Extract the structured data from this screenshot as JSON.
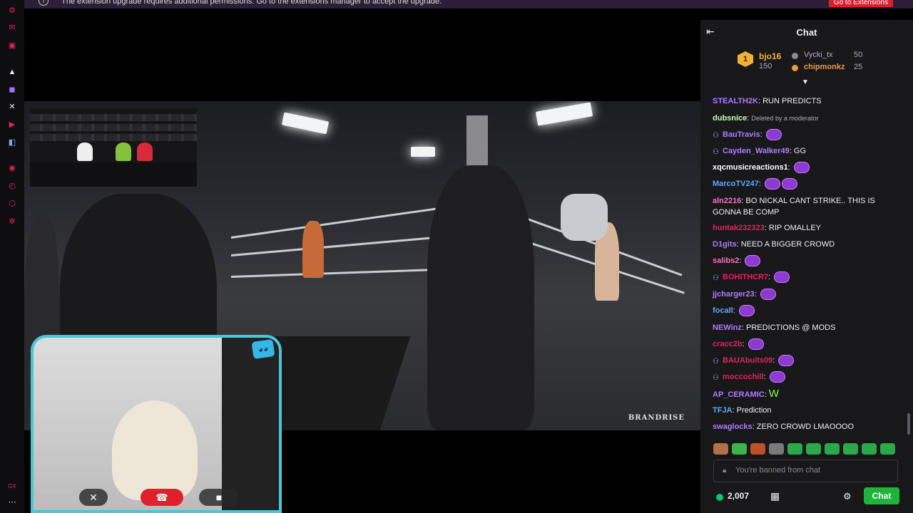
{
  "notification": {
    "message": "The extension upgrade requires additional permissions. Go to the extensions manager to accept the upgrade.",
    "button": "Go to Extensions",
    "icon": "info-icon"
  },
  "rail": {
    "icons": [
      "red-robot-icon",
      "red-chat-icon",
      "red-card-icon",
      "white-kick-icon",
      "purple-twitch-icon",
      "white-x-icon",
      "red-youtube-icon",
      "blue-app-icon",
      "red-radio-icon",
      "red-clock-icon",
      "red-gear-icon",
      "red-settings-icon",
      "red-gx-icon",
      "white-more-icon"
    ]
  },
  "video": {
    "watermark": "BRANDRISE"
  },
  "chat": {
    "title": "Chat",
    "leaderboard": {
      "first": {
        "rank": "1",
        "name": "bjo16",
        "points": "150"
      },
      "second": {
        "name": "Vycki_tx",
        "points": "50"
      },
      "third": {
        "name": "chipmonkz",
        "points": "25"
      }
    },
    "messages": [
      {
        "user": "STEALTH2K",
        "color": "#b07cff",
        "text": "RUN PREDICTS"
      },
      {
        "user": "dubsnice",
        "color": "#c7ffb3",
        "text": "Deleted by a moderator",
        "deleted": true
      },
      {
        "user": "BauTravis",
        "color": "#b07cff",
        "text": "",
        "emotes": 1,
        "badge": true
      },
      {
        "user": "Cayden_Walker49",
        "color": "#b07cff",
        "text": "GG",
        "badge": true
      },
      {
        "user": "xqcmusicreactions1",
        "color": "#ffffff",
        "text": "",
        "emotes": 1
      },
      {
        "user": "MarcoTV247",
        "color": "#5fa9ff",
        "text": "",
        "emotes": 2
      },
      {
        "user": "aln2216",
        "color": "#ff6ec7",
        "text": "BO NICKAL CANT STRIKE.. THIS IS GONNA BE COMP"
      },
      {
        "user": "huntak232323",
        "color": "#e0245e",
        "text": "RIP OMALLEY"
      },
      {
        "user": "D1gits",
        "color": "#b07cff",
        "text": "NEED A BIGGER CROWD"
      },
      {
        "user": "salibs2",
        "color": "#ff6ec7",
        "text": "",
        "emotes": 1
      },
      {
        "user": "BOHITHCR7",
        "color": "#e0245e",
        "text": "",
        "emotes": 1,
        "badge": true
      },
      {
        "user": "jjcharger23",
        "color": "#b07cff",
        "text": "",
        "emotes": 1
      },
      {
        "user": "focall",
        "color": "#5fa9ff",
        "text": "",
        "emotes": 1
      },
      {
        "user": "NEWinz",
        "color": "#b07cff",
        "text": "PREDICTIONS @ MODS"
      },
      {
        "user": "cracc2b",
        "color": "#e0245e",
        "text": "",
        "emotes": 1
      },
      {
        "user": "BAUAbuits09",
        "color": "#e0245e",
        "text": "",
        "emotes": 1,
        "badge": true
      },
      {
        "user": "moccochill",
        "color": "#e0245e",
        "text": "",
        "emotes": 1,
        "badge": true
      },
      {
        "user": "AP_CERAMIC",
        "color": "#b07cff",
        "text": "W"
      },
      {
        "user": "TFJA",
        "color": "#5fa9ff",
        "text": "Prediction"
      },
      {
        "user": "swaglocks",
        "color": "#b07cff",
        "text": "ZERO CROWD LMAOOOO"
      }
    ],
    "input_placeholder": "You're banned from chat",
    "points": "2,007",
    "chat_button": "Chat"
  },
  "colors": {
    "accent": "#1eb33a",
    "chat_bg": "#18181b",
    "cam_border": "#49c7d8"
  }
}
